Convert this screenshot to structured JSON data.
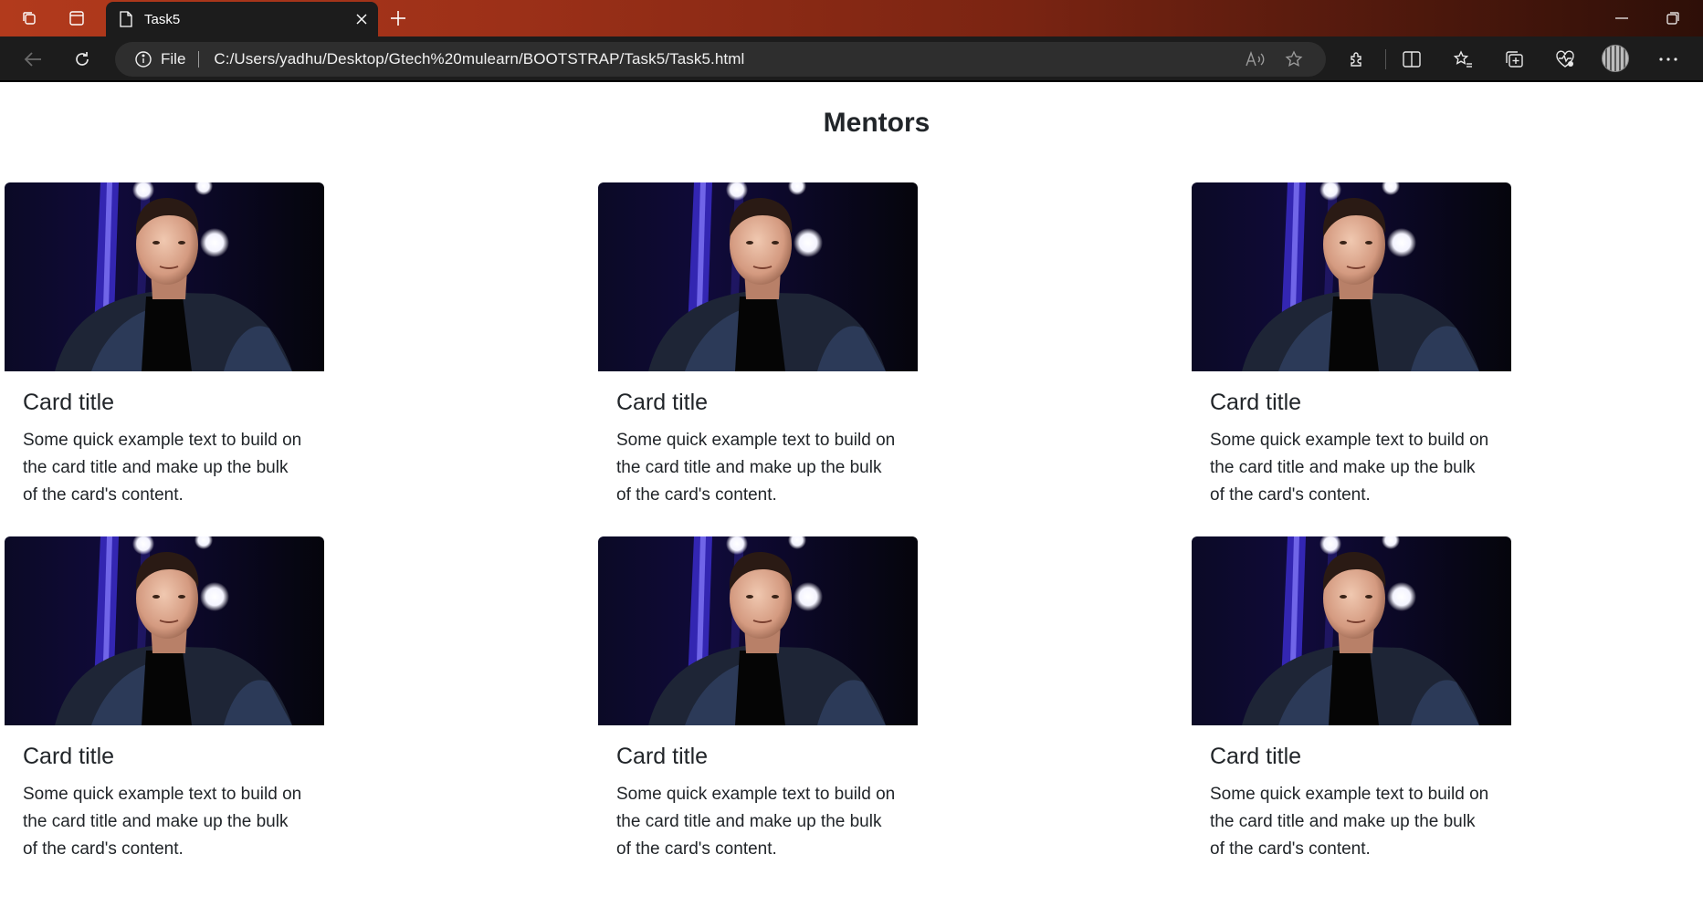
{
  "browser": {
    "tab_title": "Task5",
    "address": {
      "scheme": "File",
      "url": "C:/Users/yadhu/Desktop/Gtech%20mulearn/BOOTSTRAP/Task5/Task5.html"
    },
    "icons": [
      "workspaces-icon",
      "tab-actions-icon",
      "page-icon",
      "close-icon",
      "new-tab-icon",
      "minimize-icon",
      "restore-icon",
      "back-icon",
      "refresh-icon",
      "info-icon",
      "read-aloud-icon",
      "favorite-star-icon",
      "extensions-icon",
      "split-screen-icon",
      "favorites-icon",
      "collections-icon",
      "browser-essentials-icon",
      "more-icon"
    ],
    "accent": "#9c3018"
  },
  "page": {
    "heading": "Mentors",
    "cards": [
      {
        "title": "Card title",
        "text": "Some quick example text to build on the card title and make up the bulk of the card's content."
      },
      {
        "title": "Card title",
        "text": "Some quick example text to build on the card title and make up the bulk of the card's content."
      },
      {
        "title": "Card title",
        "text": "Some quick example text to build on the card title and make up the bulk of the card's content."
      },
      {
        "title": "Card title",
        "text": "Some quick example text to build on the card title and make up the bulk of the card's content."
      },
      {
        "title": "Card title",
        "text": "Some quick example text to build on the card title and make up the bulk of the card's content."
      },
      {
        "title": "Card title",
        "text": "Some quick example text to build on the card title and make up the bulk of the card's content."
      }
    ]
  }
}
